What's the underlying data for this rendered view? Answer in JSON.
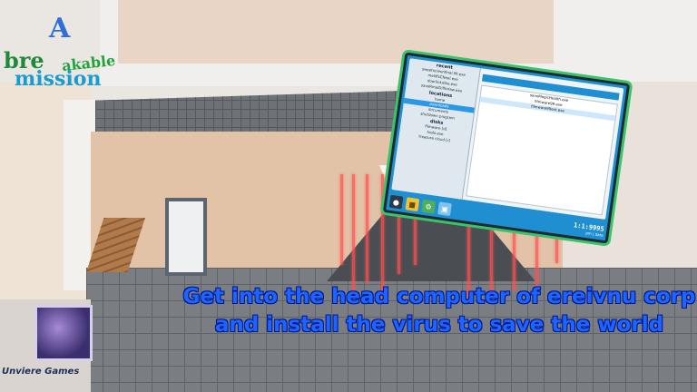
{
  "game": {
    "title_parts": [
      "A",
      "bre",
      "akable",
      "mission"
    ],
    "objective": "Get into the head computer of ereivnu corp and install the virus to save the world",
    "studio": "Unviere Games"
  },
  "tablet": {
    "sidebar_sections": [
      {
        "heading": "recent",
        "items": [
          "sweetscreenfinal.lllt.exe",
          "meliffsCNeel.exe",
          "doorlinkdibe.exe",
          "saveRmalDifferlaw.exe"
        ]
      },
      {
        "heading": "locations",
        "items": [
          "home",
          "downloads",
          "documents",
          "shutdown program"
        ]
      },
      {
        "heading": "disks",
        "items": [
          "filmware [d]",
          "tools.exe",
          "treasure cloud [r]"
        ]
      }
    ],
    "active_sidebar_item": "downloads",
    "files": [
      "saveMagicHealth.exe",
      "filmware99.exe",
      "filmware99ext.exe"
    ],
    "active_file": "filmware99ext.exe",
    "clock_time": "1:1:9995",
    "clock_sub": "pm | date"
  },
  "colors": {
    "objective_text": "#1e64ff",
    "tablet_frame": "#1f8fd2",
    "tablet_border": "#3cc26b",
    "laser": "#ff5050"
  }
}
